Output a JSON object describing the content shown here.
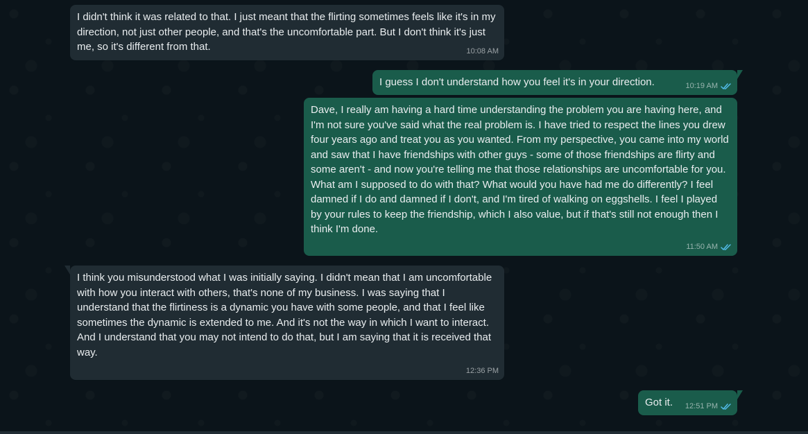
{
  "colors": {
    "background": "#0b141a",
    "incoming_bubble": "#202c33",
    "outgoing_bubble": "#1a5c4b",
    "read_receipt": "#53bdeb"
  },
  "messages": [
    {
      "direction": "incoming",
      "paragraphs": [
        "I didn't think it was related to that. I just meant that the flirting sometimes feels like it's in my direction, not just other people, and that's the uncomfortable part. But I don't think it's just me, so it's different from that."
      ],
      "time": "10:08 AM"
    },
    {
      "direction": "outgoing",
      "paragraphs": [
        "I guess I don't understand how you feel it's in your direction."
      ],
      "time": "10:19 AM",
      "status_icon": "double-check-read-icon"
    },
    {
      "direction": "outgoing",
      "paragraphs": [
        "Dave, I really am having a hard time understanding the problem you are having here, and I'm not sure you've said what the real problem is. I have tried to respect the lines you drew four years ago and treat you as you wanted. From my perspective, you came into my world and saw that I have friendships with other guys - some of those friendships are flirty and some aren't - and now you're telling me that those relationships are uncomfortable for you. What am I supposed to do with that? What would you have had me do differently? I feel damned if I do and damned if I don't, and I'm tired of walking on eggshells. I feel I played by your rules to keep the friendship, which I also value, but if that's still not enough then I think I'm done."
      ],
      "time": "11:50 AM",
      "status_icon": "double-check-read-icon"
    },
    {
      "direction": "incoming",
      "paragraphs": [
        "I think you misunderstood what I was initially saying. I didn't mean that I am uncomfortable with how you interact with others, that's none of my business. I was saying that I understand that the flirtiness is a dynamic you have with some people, and that I feel like sometimes the dynamic is extended to me. And it's not the way in which I want to interact.",
        "And I understand that you may not intend to do that, but I am saying that it is received that way."
      ],
      "time": "12:36 PM"
    },
    {
      "direction": "outgoing",
      "paragraphs": [
        "Got it."
      ],
      "time": "12:51 PM",
      "status_icon": "double-check-read-icon"
    }
  ]
}
